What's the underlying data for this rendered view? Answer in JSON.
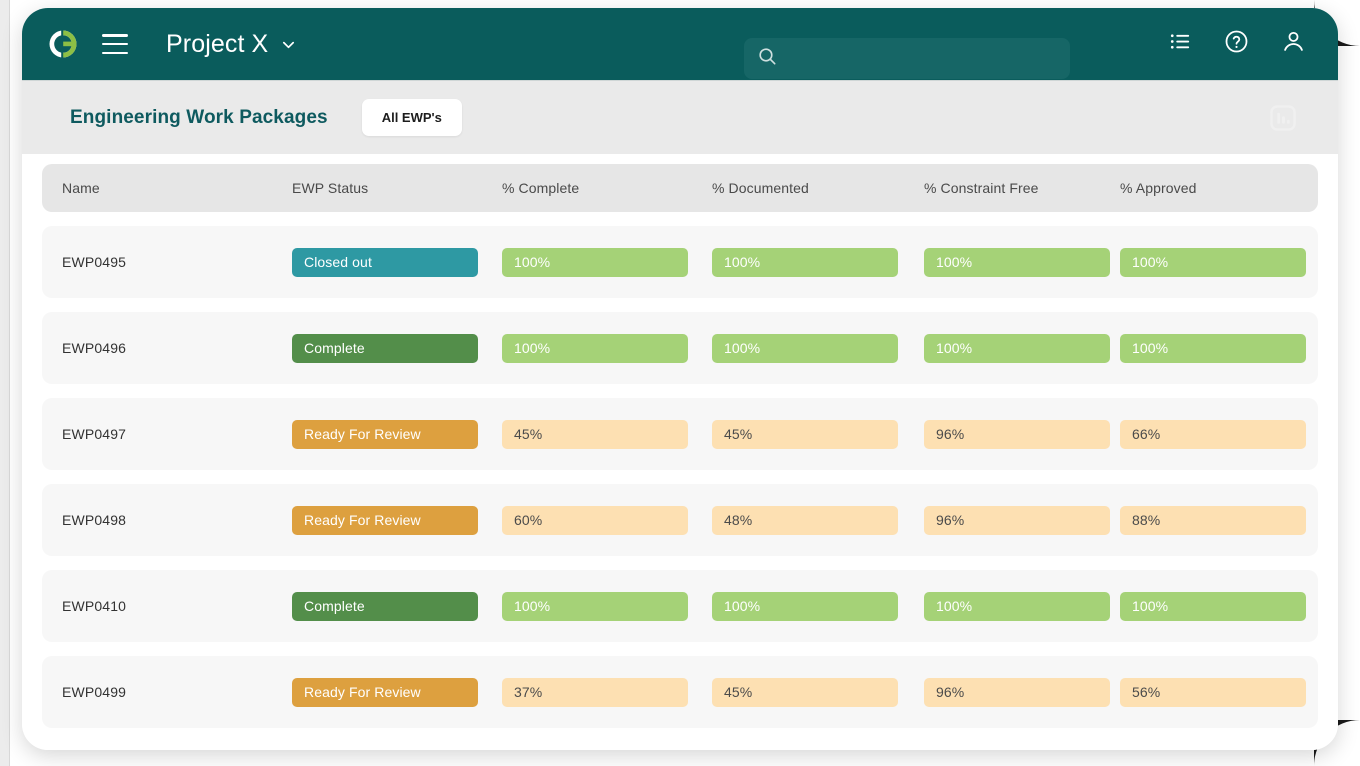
{
  "topbar": {
    "logo_icon": "circular-g-logo-icon",
    "menu_icon": "hamburger-menu-icon",
    "project_title": "Project X",
    "project_dropdown_icon": "chevron-down-icon",
    "search": {
      "icon": "search-icon",
      "value": "",
      "placeholder": ""
    },
    "icons": [
      {
        "name": "list-icon",
        "label": "List"
      },
      {
        "name": "help-circle-icon",
        "label": "Help"
      },
      {
        "name": "user-account-icon",
        "label": "Account"
      }
    ],
    "background_color": "#0a5c5c"
  },
  "subheader": {
    "page_title": "Engineering Work Packages",
    "title_color": "#0e5a5f",
    "tab_label": "All EWP's",
    "chart_toggle_icon": "bar-chart-icon",
    "background_color": "#eaeaea"
  },
  "table": {
    "columns": [
      "Name",
      "EWP Status",
      "% Complete",
      "% Documented",
      "% Constraint Free",
      "% Approved"
    ],
    "status_colors": {
      "Closed out": "#2e99a3",
      "Complete": "#538e4a",
      "Ready For Review": "#dda03f"
    },
    "rows": [
      {
        "name": "EWP0495",
        "status": "Closed out",
        "status_color": "#2e99a3",
        "complete": "100%",
        "documented": "100%",
        "constraint_free": "100%",
        "approved": "100%",
        "complete_level": "high",
        "documented_level": "high",
        "constraint_free_level": "high",
        "approved_level": "high"
      },
      {
        "name": "EWP0496",
        "status": "Complete",
        "status_color": "#538e4a",
        "complete": "100%",
        "documented": "100%",
        "constraint_free": "100%",
        "approved": "100%",
        "complete_level": "high",
        "documented_level": "high",
        "constraint_free_level": "high",
        "approved_level": "high"
      },
      {
        "name": "EWP0497",
        "status": "Ready For Review",
        "status_color": "#dda03f",
        "complete": "45%",
        "documented": "45%",
        "constraint_free": "96%",
        "approved": "66%",
        "complete_level": "low",
        "documented_level": "low",
        "constraint_free_level": "low",
        "approved_level": "low"
      },
      {
        "name": "EWP0498",
        "status": "Ready For Review",
        "status_color": "#dda03f",
        "complete": "60%",
        "documented": "48%",
        "constraint_free": "96%",
        "approved": "88%",
        "complete_level": "low",
        "documented_level": "low",
        "constraint_free_level": "low",
        "approved_level": "low"
      },
      {
        "name": "EWP0410",
        "status": "Complete",
        "status_color": "#538e4a",
        "complete": "100%",
        "documented": "100%",
        "constraint_free": "100%",
        "approved": "100%",
        "complete_level": "high",
        "documented_level": "high",
        "constraint_free_level": "high",
        "approved_level": "high"
      },
      {
        "name": "EWP0499",
        "status": "Ready For Review",
        "status_color": "#dda03f",
        "complete": "37%",
        "documented": "45%",
        "constraint_free": "96%",
        "approved": "56%",
        "complete_level": "low",
        "documented_level": "low",
        "constraint_free_level": "low",
        "approved_level": "low"
      }
    ]
  }
}
